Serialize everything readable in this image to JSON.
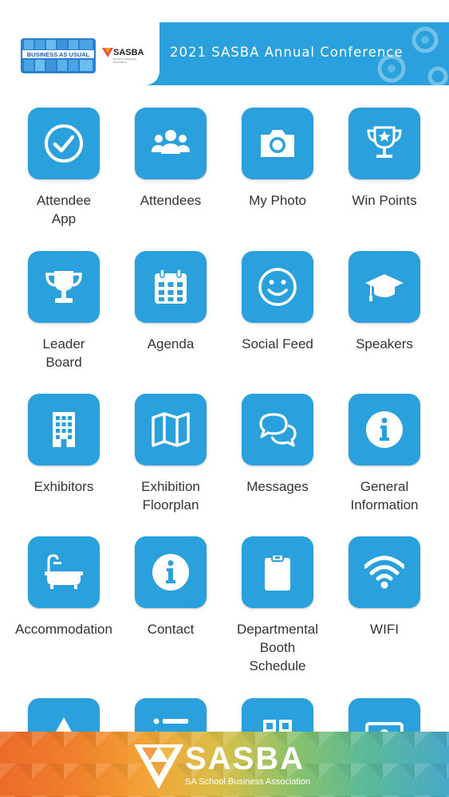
{
  "header": {
    "title": "2021 SASBA Annual Conference",
    "logo_text": "BUSINESS AS USUAL",
    "partner_logo_text": "SASBA",
    "partner_logo_sub": "SA School Business Association"
  },
  "tiles": [
    {
      "label": "Attendee\nApp",
      "icon": "check-circle-icon"
    },
    {
      "label": "Attendees",
      "icon": "people-group-icon"
    },
    {
      "label": "My Photo",
      "icon": "camera-icon"
    },
    {
      "label": "Win Points",
      "icon": "trophy-star-icon"
    },
    {
      "label": "Leader\nBoard",
      "icon": "trophy-icon"
    },
    {
      "label": "Agenda",
      "icon": "calendar-icon"
    },
    {
      "label": "Social Feed",
      "icon": "smiley-icon"
    },
    {
      "label": "Speakers",
      "icon": "graduation-cap-icon"
    },
    {
      "label": "Exhibitors",
      "icon": "building-icon"
    },
    {
      "label": "Exhibition\nFloorplan",
      "icon": "map-icon"
    },
    {
      "label": "Messages",
      "icon": "chat-bubbles-icon"
    },
    {
      "label": "General\nInformation",
      "icon": "info-icon"
    },
    {
      "label": "Accommodation",
      "icon": "bathtub-icon"
    },
    {
      "label": "Contact",
      "icon": "info-icon"
    },
    {
      "label": "Departmental\nBooth\nSchedule",
      "icon": "clipboard-icon"
    },
    {
      "label": "WIFI",
      "icon": "wifi-icon"
    },
    {
      "label": "",
      "icon": "warning-icon"
    },
    {
      "label": "",
      "icon": "list-icon"
    },
    {
      "label": "",
      "icon": "grid-icon"
    },
    {
      "label": "",
      "icon": "money-icon"
    }
  ],
  "footer": {
    "brand": "SASBA",
    "brand_sub": "SA School Business Association"
  },
  "colors": {
    "accent": "#2aa0dc",
    "label_text": "#333333"
  }
}
